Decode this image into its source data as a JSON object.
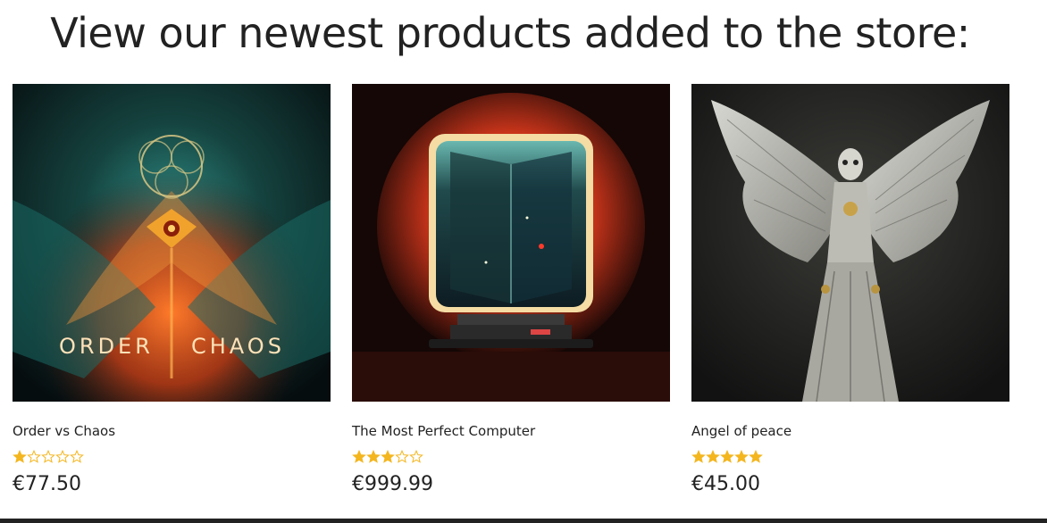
{
  "section": {
    "heading": "View our newest products added to the store:"
  },
  "products": [
    {
      "title": "Order vs Chaos",
      "price": "€77.50",
      "rating": 1,
      "image_text_left": "ORDER",
      "image_text_right": "CHAOS",
      "image_icon": "order-vs-chaos-artwork-icon"
    },
    {
      "title": "The Most Perfect Computer",
      "price": "€999.99",
      "rating": 3,
      "image_icon": "retro-computer-artwork-icon"
    },
    {
      "title": "Angel of peace",
      "price": "€45.00",
      "rating": 5,
      "image_icon": "angel-artwork-icon"
    }
  ],
  "colors": {
    "star": "#f4b61f",
    "text": "#222222",
    "footer": "#222222"
  }
}
